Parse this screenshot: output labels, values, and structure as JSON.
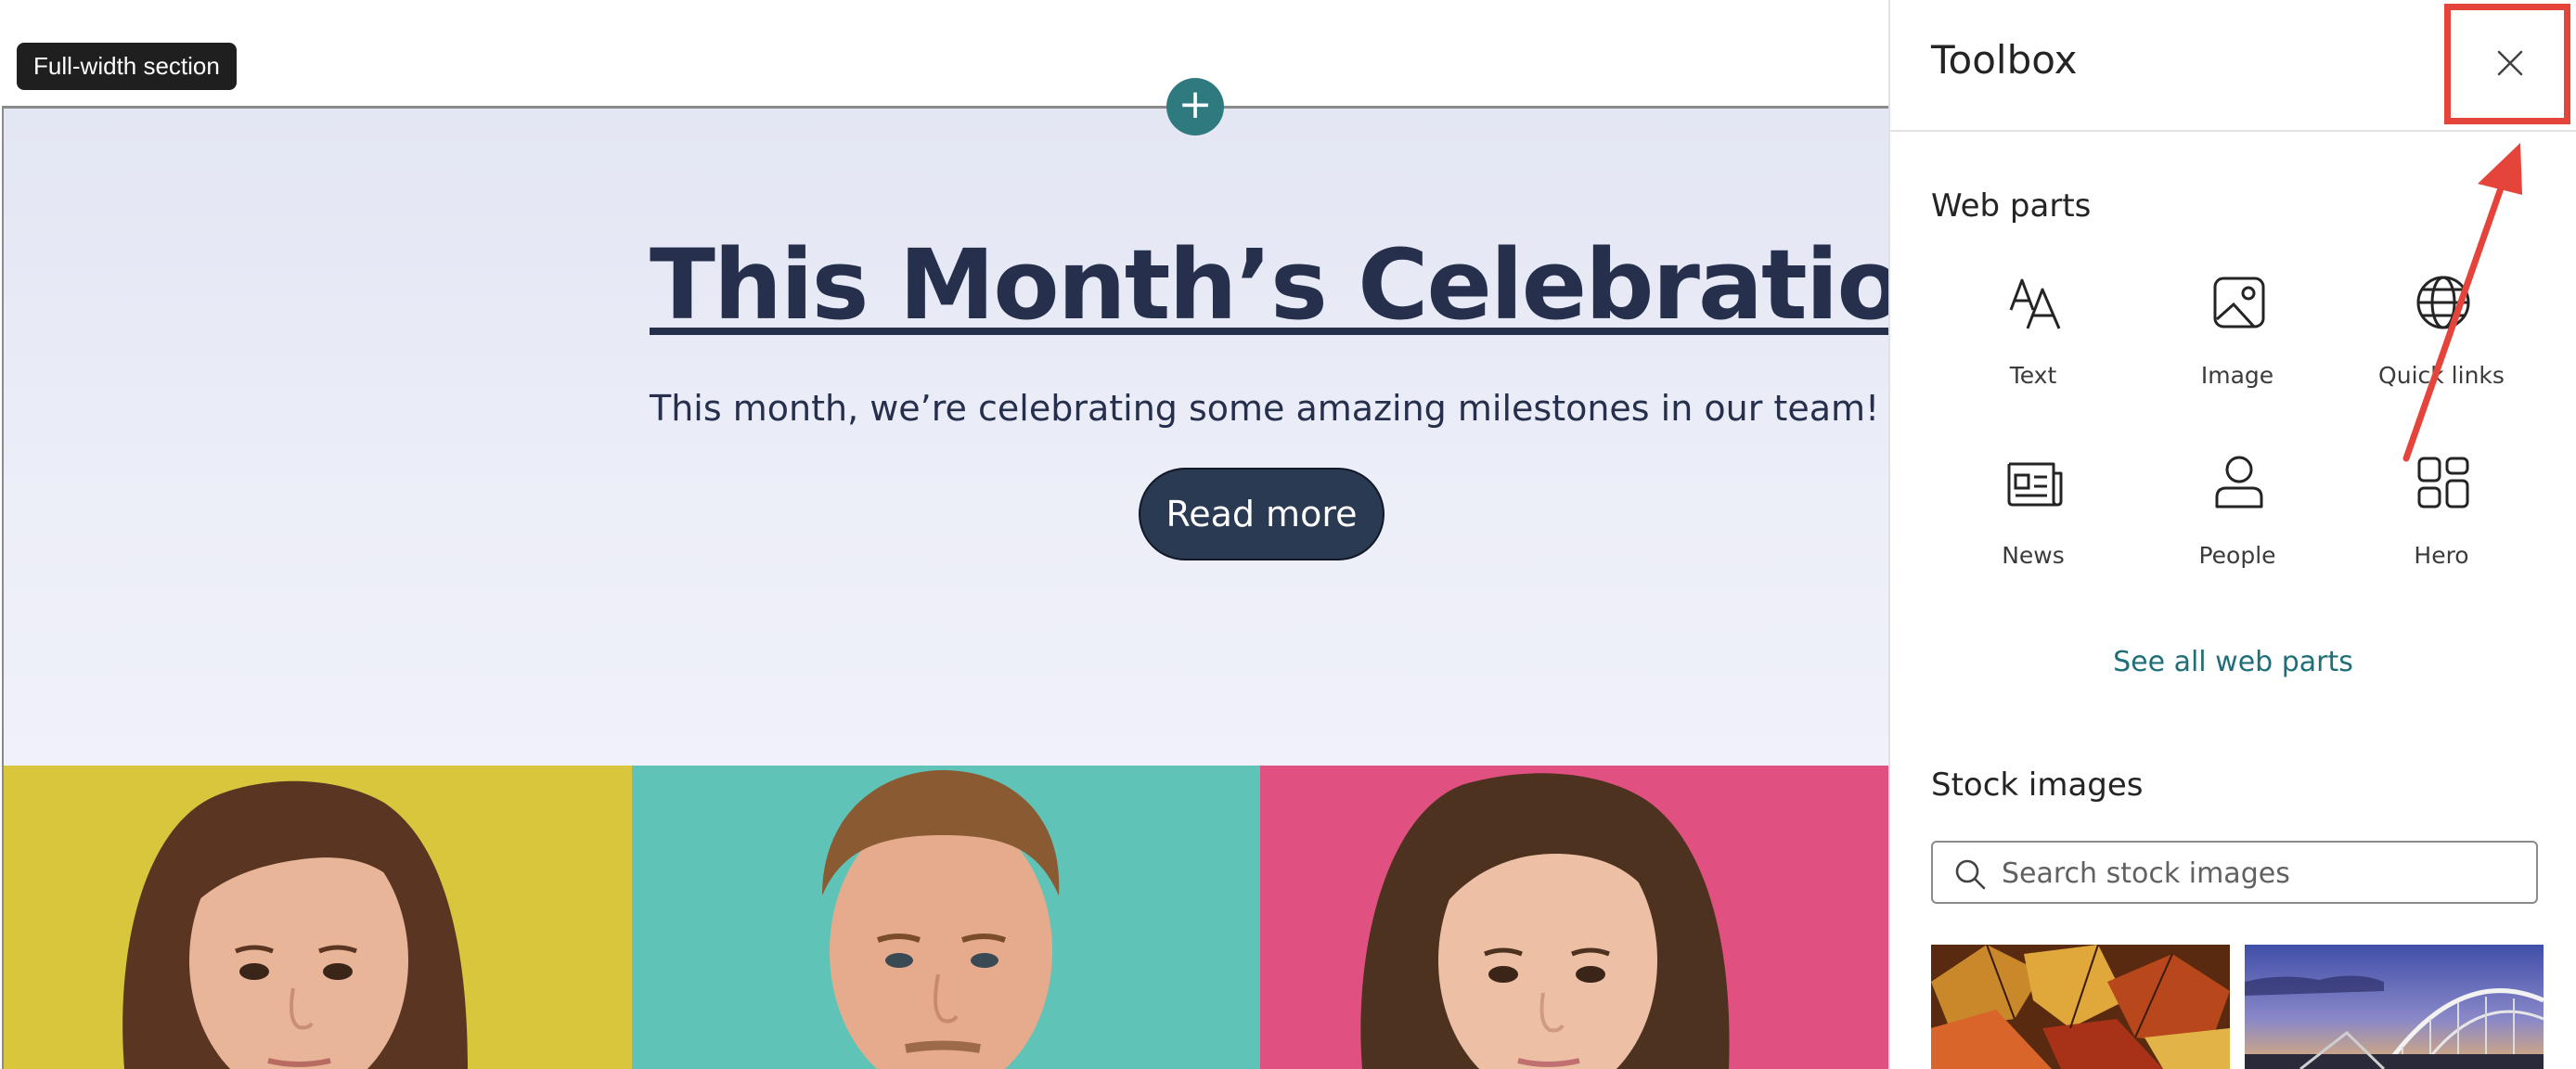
{
  "canvas": {
    "section_tag": "Full-width section",
    "add_section_symbol": "+",
    "hero": {
      "title": "This Month’s Celebrations!",
      "subtitle": "This month, we’re celebrating some amazing milestones in our team!",
      "button_label": "Read more"
    },
    "photos": [
      {
        "background": "#d9c63d",
        "person": "woman-long-hair"
      },
      {
        "background": "#5fc4b7",
        "person": "man-short-hair"
      },
      {
        "background": "#e05081",
        "person": "woman-long-hair"
      }
    ]
  },
  "toolbox": {
    "title": "Toolbox",
    "close_icon": "close-icon",
    "web_parts_heading": "Web parts",
    "web_parts": [
      {
        "label": "Text",
        "icon": "text-icon"
      },
      {
        "label": "Image",
        "icon": "image-icon"
      },
      {
        "label": "Quick links",
        "icon": "globe-icon"
      },
      {
        "label": "News",
        "icon": "news-icon"
      },
      {
        "label": "People",
        "icon": "person-icon"
      },
      {
        "label": "Hero",
        "icon": "hero-layout-icon"
      }
    ],
    "see_all_label": "See all web parts",
    "stock_images_heading": "Stock images",
    "search_placeholder": "Search stock images",
    "thumbnails": [
      {
        "subject": "autumn-leaves"
      },
      {
        "subject": "bridge-at-dusk"
      }
    ]
  },
  "colors": {
    "accent_teal": "#2f7a7f",
    "link_teal": "#1f6f79",
    "hero_text": "#26304d",
    "button_bg": "#2a3a52",
    "annotation_red": "#e5443a"
  }
}
